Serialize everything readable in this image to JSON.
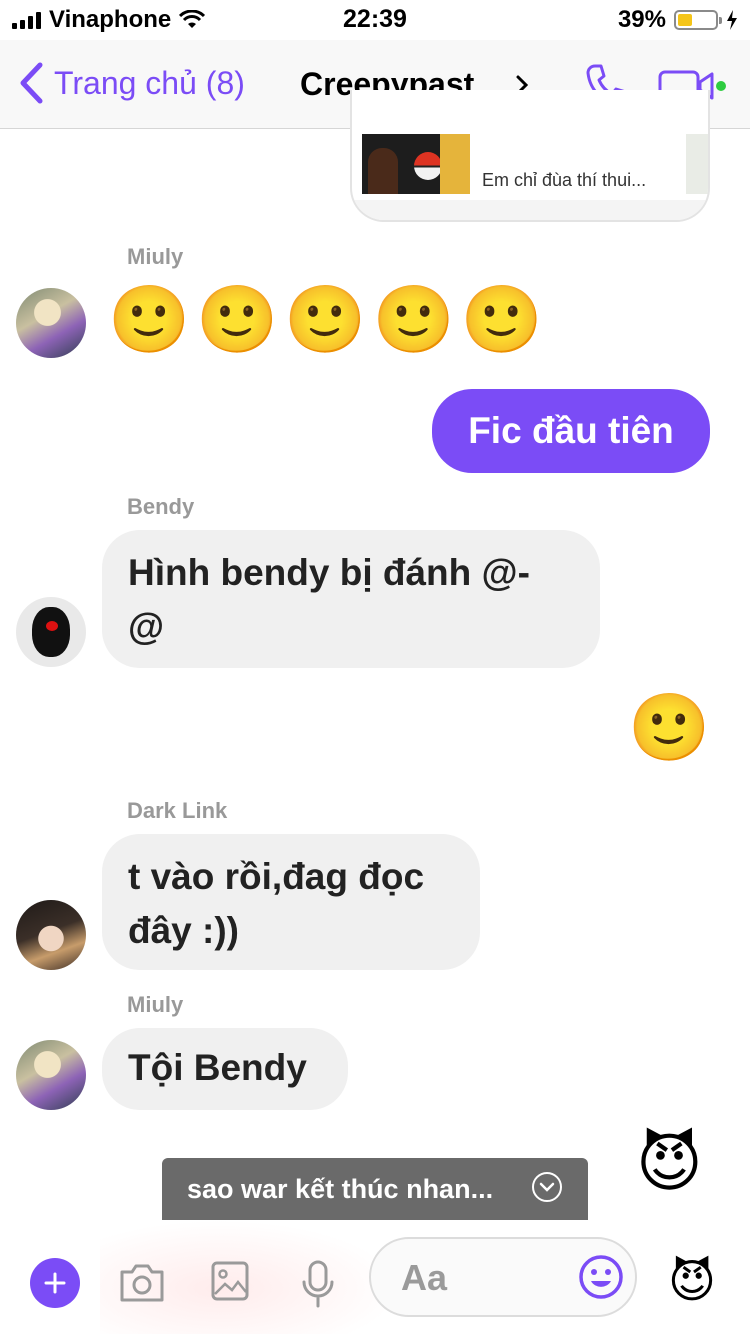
{
  "status_bar": {
    "carrier": "Vinaphone",
    "time": "22:39",
    "battery_percent": "39%",
    "battery_level": 0.39
  },
  "nav": {
    "back_label": "Trang chủ (8)",
    "title": "Creepypast...",
    "accent": "#7b4cf6"
  },
  "attachment": {
    "preview_text": "Em chỉ đùa thí thui..."
  },
  "messages": {
    "miuly_name_1": "Miuly",
    "miuly_emojis": [
      "🙂",
      "🙂",
      "🙂",
      "🙂",
      "🙂"
    ],
    "out_1": "Fic đầu tiên",
    "bendy_name": "Bendy",
    "bendy_text_line1": "Hình bendy bị đánh @-",
    "bendy_text_line2": "@",
    "out_emoji": "🙂",
    "dark_link_name": "Dark Link",
    "dark_link_line1": "t vào rồi,đag đọc",
    "dark_link_line2": "đây :))",
    "miuly_name_2": "Miuly",
    "miuly_text": "Tội Bendy",
    "devil_emoji": "😈"
  },
  "toast": {
    "text": "sao war kết thúc nhan..."
  },
  "composer": {
    "placeholder": "Aa",
    "like_emoji": "😈"
  }
}
